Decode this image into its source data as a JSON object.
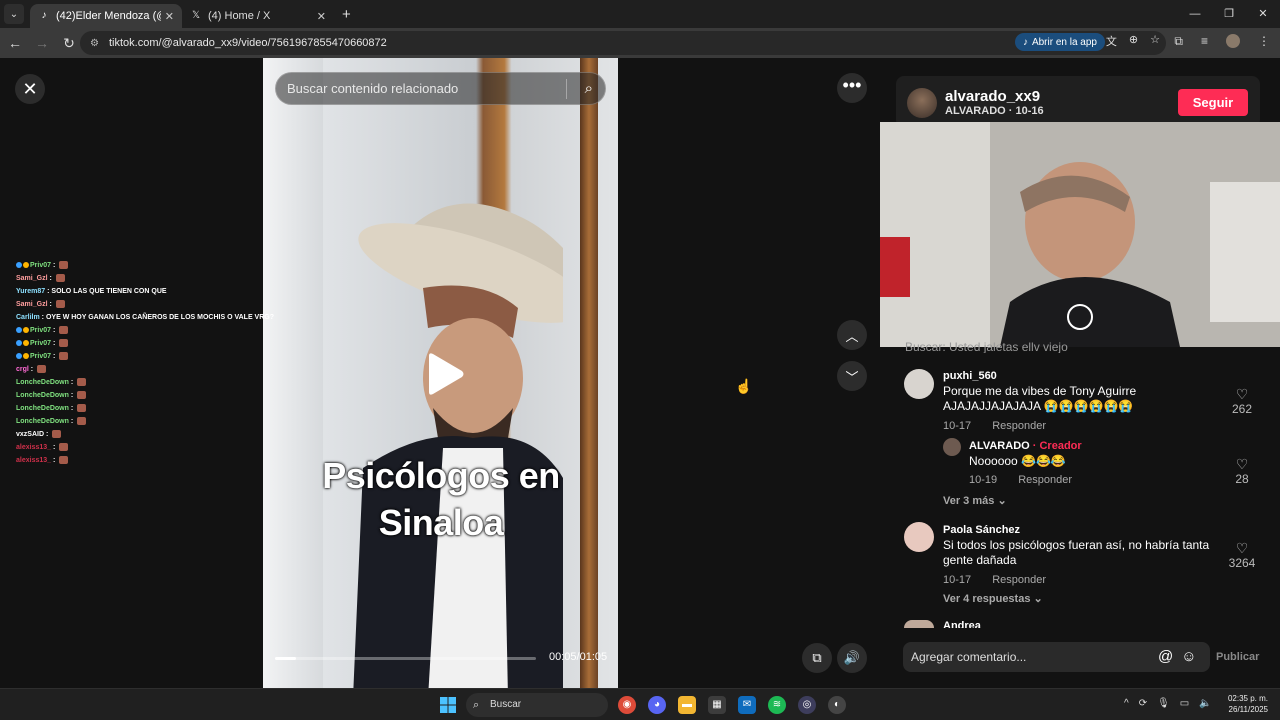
{
  "browser": {
    "tabs": [
      {
        "title": "(42)Elder Mendoza (@elderme",
        "icon": "tiktok-icon",
        "active": true
      },
      {
        "title": "(4) Home / X",
        "icon": "x-icon",
        "active": false
      }
    ],
    "new_tab": "+",
    "url": "tiktok.com/@alvarado_xx9/video/7561967855470660872",
    "open_in_app": "Abrir en la app"
  },
  "video": {
    "search_placeholder": "Buscar contenido relacionado",
    "caption_line1": "Psicólogos en",
    "caption_line2": "Sinaloa",
    "time": "00:05/01:05",
    "progress": 0.08
  },
  "chat": [
    {
      "user": "Priv07",
      "msg": "",
      "color": "#7fe07f",
      "badges": [
        "#3aa0ff",
        "#ffb400"
      ]
    },
    {
      "user": "Sami_Gzl",
      "msg": "",
      "color": "#ff9d9d",
      "badges": []
    },
    {
      "user": "Yurem87",
      "msg": "SOLO LAS QUE TIENEN CON QUE",
      "color": "#8de0ff",
      "badges": []
    },
    {
      "user": "Sami_Gzl",
      "msg": "",
      "color": "#ff9d9d",
      "badges": []
    },
    {
      "user": "Carlilm",
      "msg": "OYE W HOY GANAN LOS CAÑEROS DE LOS MOCHIS O VALE VRG?",
      "color": "#8de0ff",
      "badges": []
    },
    {
      "user": "Priv07",
      "msg": "",
      "color": "#7fe07f",
      "badges": [
        "#3aa0ff",
        "#ffb400"
      ]
    },
    {
      "user": "Priv07",
      "msg": "",
      "color": "#7fe07f",
      "badges": [
        "#3aa0ff",
        "#ffb400"
      ]
    },
    {
      "user": "Priv07",
      "msg": "",
      "color": "#7fe07f",
      "badges": [
        "#3aa0ff",
        "#ffb400"
      ]
    },
    {
      "user": "crgl",
      "msg": "",
      "color": "#ff6ad5",
      "badges": []
    },
    {
      "user": "LoncheDeDown",
      "msg": "",
      "color": "#7fe07f",
      "badges": []
    },
    {
      "user": "LoncheDeDown",
      "msg": "",
      "color": "#7fe07f",
      "badges": []
    },
    {
      "user": "LoncheDeDown",
      "msg": "",
      "color": "#7fe07f",
      "badges": []
    },
    {
      "user": "LoncheDeDown",
      "msg": "",
      "color": "#7fe07f",
      "badges": []
    },
    {
      "user": "vxzSAID",
      "msg": "",
      "color": "#ffffff",
      "badges": []
    },
    {
      "user": "alexiss13_",
      "msg": "",
      "color": "#d0304a",
      "badges": []
    },
    {
      "user": "alexiss13_",
      "msg": "",
      "color": "#d0304a",
      "badges": []
    }
  ],
  "author": {
    "username": "alvarado_xx9",
    "subtitle": "ALVARADO · 10-16",
    "follow_label": "Seguir"
  },
  "comments_cutoff": "Buscar: Usted jaletas ellv viejo",
  "comments": [
    {
      "user": "puxhi_560",
      "text": "Porque me da vibes de Tony Aguirre AJAJAJJAJAJAJA 😭😭😭😭😭😭",
      "date": "10-17",
      "reply": "Responder",
      "likes": "262"
    },
    {
      "user": "ALVARADO",
      "creator": "· Creador",
      "text": "Noooooo 😂😂😂",
      "date": "10-19",
      "reply": "Responder",
      "likes": "28"
    },
    {
      "user": "Paola Sánchez",
      "text": "Si todos los psicólogos fueran así, no habría tanta gente dañada",
      "date": "10-17",
      "reply": "Responder",
      "likes": "3264"
    },
    {
      "user": "Andrea",
      "text": "",
      "date": "",
      "reply": "",
      "likes": ""
    }
  ],
  "more_replies_1": "Ver 3 más",
  "more_replies_2": "Ver 4 respuestas",
  "comment_input_placeholder": "Agregar comentario...",
  "publish_label": "Publicar",
  "taskbar": {
    "search_label": "Buscar",
    "time": "02:35 p. m.",
    "date": "26/11/2025"
  },
  "colors": {
    "accent": "#fe2c55",
    "bg": "#121212"
  }
}
